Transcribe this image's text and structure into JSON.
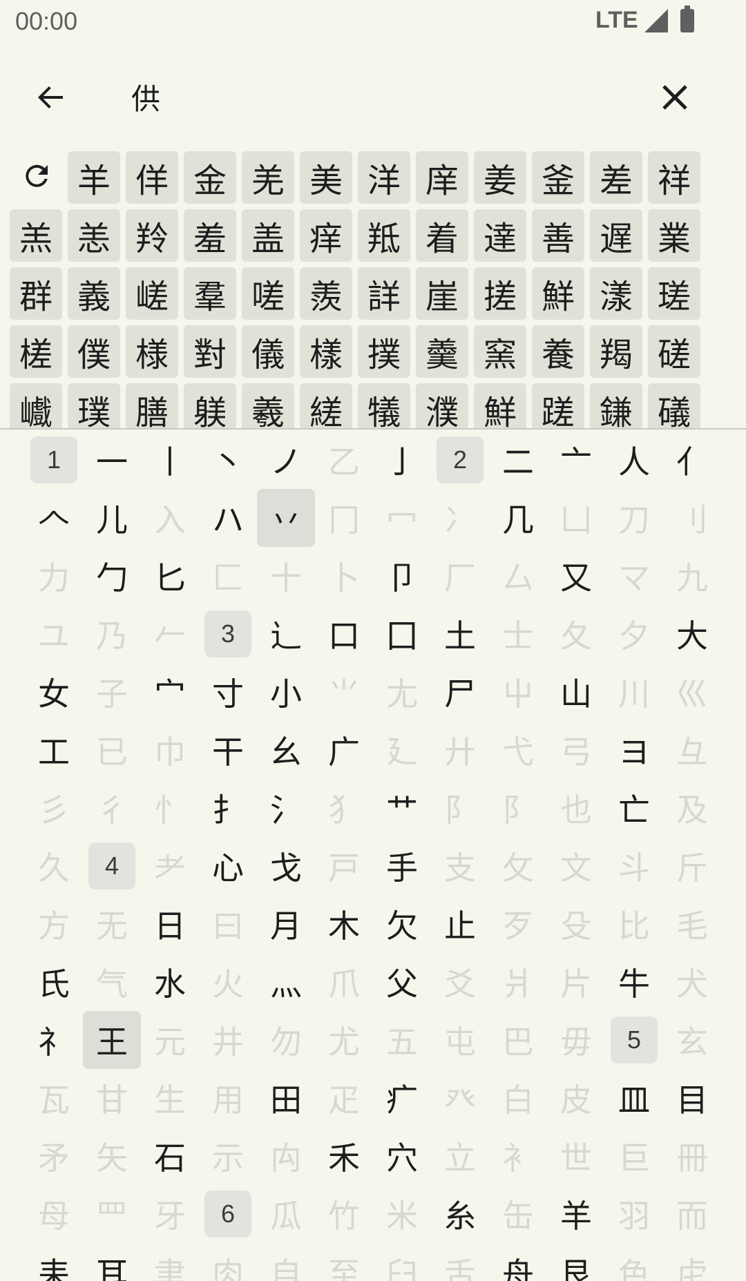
{
  "status_bar": {
    "time": "00:00",
    "network": "LTE"
  },
  "toolbar": {
    "query": "供"
  },
  "results": [
    "羊",
    "佯",
    "金",
    "羌",
    "美",
    "洋",
    "庠",
    "姜",
    "釜",
    "差",
    "祥",
    "羔",
    "恙",
    "羚",
    "羞",
    "盖",
    "痒",
    "羝",
    "着",
    "達",
    "善",
    "遅",
    "業",
    "群",
    "義",
    "嵯",
    "羣",
    "嗟",
    "羨",
    "詳",
    "崖",
    "搓",
    "鮮",
    "漾",
    "瑳",
    "槎",
    "僕",
    "様",
    "對",
    "儀",
    "樣",
    "撲",
    "羹",
    "窯",
    "養",
    "羯",
    "磋",
    "巇",
    "璞",
    "膳",
    "躾",
    "羲",
    "縒",
    "犠",
    "濮",
    "鮮",
    "蹉",
    "鎌",
    "礒"
  ],
  "radicals": [
    {
      "type": "stroke",
      "label": "1"
    },
    {
      "c": "一",
      "on": true
    },
    {
      "c": "丨",
      "on": true
    },
    {
      "c": "丶",
      "on": true
    },
    {
      "c": "ノ",
      "on": true
    },
    {
      "c": "乙",
      "on": false
    },
    {
      "c": "亅",
      "on": true
    },
    {
      "type": "stroke",
      "label": "2"
    },
    {
      "c": "二",
      "on": true
    },
    {
      "c": "亠",
      "on": true
    },
    {
      "c": "人",
      "on": true
    },
    {
      "c": "亻",
      "on": true
    },
    {
      "c": "𠆢",
      "on": true
    },
    {
      "c": "儿",
      "on": true
    },
    {
      "c": "入",
      "on": false
    },
    {
      "c": "ハ",
      "on": true
    },
    {
      "c": "丷",
      "on": true,
      "sel": true
    },
    {
      "c": "冂",
      "on": false
    },
    {
      "c": "冖",
      "on": false
    },
    {
      "c": "冫",
      "on": false
    },
    {
      "c": "几",
      "on": true
    },
    {
      "c": "凵",
      "on": false
    },
    {
      "c": "刀",
      "on": false
    },
    {
      "c": "刂",
      "on": false
    },
    {
      "c": "力",
      "on": false
    },
    {
      "c": "勹",
      "on": true
    },
    {
      "c": "匕",
      "on": true
    },
    {
      "c": "匚",
      "on": false
    },
    {
      "c": "十",
      "on": false
    },
    {
      "c": "卜",
      "on": false
    },
    {
      "c": "卩",
      "on": true
    },
    {
      "c": "厂",
      "on": false
    },
    {
      "c": "厶",
      "on": false
    },
    {
      "c": "又",
      "on": true
    },
    {
      "c": "マ",
      "on": false
    },
    {
      "c": "九",
      "on": false
    },
    {
      "c": "ユ",
      "on": false
    },
    {
      "c": "乃",
      "on": false
    },
    {
      "c": "𠂉",
      "on": false
    },
    {
      "type": "stroke",
      "label": "3"
    },
    {
      "c": "⻌",
      "on": true
    },
    {
      "c": "口",
      "on": true
    },
    {
      "c": "囗",
      "on": true
    },
    {
      "c": "土",
      "on": true
    },
    {
      "c": "士",
      "on": false
    },
    {
      "c": "夂",
      "on": false
    },
    {
      "c": "夕",
      "on": false
    },
    {
      "c": "大",
      "on": true
    },
    {
      "c": "女",
      "on": true
    },
    {
      "c": "子",
      "on": false
    },
    {
      "c": "宀",
      "on": true
    },
    {
      "c": "寸",
      "on": true
    },
    {
      "c": "小",
      "on": true
    },
    {
      "c": "⺌",
      "on": false
    },
    {
      "c": "尢",
      "on": false
    },
    {
      "c": "尸",
      "on": true
    },
    {
      "c": "屮",
      "on": false
    },
    {
      "c": "山",
      "on": true
    },
    {
      "c": "川",
      "on": false
    },
    {
      "c": "巛",
      "on": false
    },
    {
      "c": "工",
      "on": true
    },
    {
      "c": "已",
      "on": false
    },
    {
      "c": "巾",
      "on": false
    },
    {
      "c": "干",
      "on": true
    },
    {
      "c": "幺",
      "on": true
    },
    {
      "c": "广",
      "on": true
    },
    {
      "c": "廴",
      "on": false
    },
    {
      "c": "廾",
      "on": false
    },
    {
      "c": "弋",
      "on": false
    },
    {
      "c": "弓",
      "on": false
    },
    {
      "c": "ヨ",
      "on": true
    },
    {
      "c": "彑",
      "on": false
    },
    {
      "c": "彡",
      "on": false
    },
    {
      "c": "彳",
      "on": false
    },
    {
      "c": "⺖",
      "on": false
    },
    {
      "c": "扌",
      "on": true
    },
    {
      "c": "氵",
      "on": true
    },
    {
      "c": "犭",
      "on": false
    },
    {
      "c": "艹",
      "on": true
    },
    {
      "c": "阝",
      "on": false
    },
    {
      "c": "阝",
      "on": false
    },
    {
      "c": "也",
      "on": false
    },
    {
      "c": "亡",
      "on": true
    },
    {
      "c": "及",
      "on": false
    },
    {
      "c": "久",
      "on": false
    },
    {
      "type": "stroke",
      "label": "4"
    },
    {
      "c": "耂",
      "on": false
    },
    {
      "c": "心",
      "on": true
    },
    {
      "c": "戈",
      "on": true
    },
    {
      "c": "戸",
      "on": false
    },
    {
      "c": "手",
      "on": true
    },
    {
      "c": "支",
      "on": false
    },
    {
      "c": "攵",
      "on": false
    },
    {
      "c": "文",
      "on": false
    },
    {
      "c": "斗",
      "on": false
    },
    {
      "c": "斤",
      "on": false
    },
    {
      "c": "方",
      "on": false
    },
    {
      "c": "无",
      "on": false
    },
    {
      "c": "日",
      "on": true
    },
    {
      "c": "曰",
      "on": false
    },
    {
      "c": "月",
      "on": true
    },
    {
      "c": "木",
      "on": true
    },
    {
      "c": "欠",
      "on": true
    },
    {
      "c": "止",
      "on": true
    },
    {
      "c": "歹",
      "on": false
    },
    {
      "c": "殳",
      "on": false
    },
    {
      "c": "比",
      "on": false
    },
    {
      "c": "毛",
      "on": false
    },
    {
      "c": "氏",
      "on": true
    },
    {
      "c": "气",
      "on": false
    },
    {
      "c": "水",
      "on": true
    },
    {
      "c": "火",
      "on": false
    },
    {
      "c": "灬",
      "on": true
    },
    {
      "c": "爪",
      "on": false
    },
    {
      "c": "父",
      "on": true
    },
    {
      "c": "爻",
      "on": false
    },
    {
      "c": "爿",
      "on": false
    },
    {
      "c": "片",
      "on": false
    },
    {
      "c": "牛",
      "on": true
    },
    {
      "c": "犬",
      "on": false
    },
    {
      "c": "礻",
      "on": true
    },
    {
      "c": "王",
      "on": true,
      "sel": true
    },
    {
      "c": "元",
      "on": false
    },
    {
      "c": "井",
      "on": false
    },
    {
      "c": "勿",
      "on": false
    },
    {
      "c": "尤",
      "on": false
    },
    {
      "c": "五",
      "on": false
    },
    {
      "c": "屯",
      "on": false
    },
    {
      "c": "巴",
      "on": false
    },
    {
      "c": "毋",
      "on": false
    },
    {
      "type": "stroke",
      "label": "5"
    },
    {
      "c": "玄",
      "on": false
    },
    {
      "c": "瓦",
      "on": false
    },
    {
      "c": "甘",
      "on": false
    },
    {
      "c": "生",
      "on": false
    },
    {
      "c": "用",
      "on": false
    },
    {
      "c": "田",
      "on": true
    },
    {
      "c": "疋",
      "on": false
    },
    {
      "c": "疒",
      "on": true
    },
    {
      "c": "癶",
      "on": false
    },
    {
      "c": "白",
      "on": false
    },
    {
      "c": "皮",
      "on": false
    },
    {
      "c": "皿",
      "on": true
    },
    {
      "c": "目",
      "on": true
    },
    {
      "c": "矛",
      "on": false
    },
    {
      "c": "矢",
      "on": false
    },
    {
      "c": "石",
      "on": true
    },
    {
      "c": "示",
      "on": false
    },
    {
      "c": "禸",
      "on": false
    },
    {
      "c": "禾",
      "on": true
    },
    {
      "c": "穴",
      "on": true
    },
    {
      "c": "立",
      "on": false
    },
    {
      "c": "衤",
      "on": false
    },
    {
      "c": "世",
      "on": false
    },
    {
      "c": "巨",
      "on": false
    },
    {
      "c": "冊",
      "on": false
    },
    {
      "c": "母",
      "on": false
    },
    {
      "c": "罒",
      "on": false
    },
    {
      "c": "牙",
      "on": false
    },
    {
      "type": "stroke",
      "label": "6"
    },
    {
      "c": "瓜",
      "on": false
    },
    {
      "c": "竹",
      "on": false
    },
    {
      "c": "米",
      "on": false
    },
    {
      "c": "糸",
      "on": true
    },
    {
      "c": "缶",
      "on": false
    },
    {
      "c": "羊",
      "on": true
    },
    {
      "c": "羽",
      "on": false
    },
    {
      "c": "而",
      "on": false
    },
    {
      "c": "耒",
      "on": true
    },
    {
      "c": "耳",
      "on": true
    },
    {
      "c": "聿",
      "on": false
    },
    {
      "c": "肉",
      "on": false
    },
    {
      "c": "自",
      "on": false
    },
    {
      "c": "至",
      "on": false
    },
    {
      "c": "臼",
      "on": false
    },
    {
      "c": "舌",
      "on": false
    },
    {
      "c": "舟",
      "on": true
    },
    {
      "c": "艮",
      "on": true
    },
    {
      "c": "色",
      "on": false
    },
    {
      "c": "虍",
      "on": false
    }
  ]
}
